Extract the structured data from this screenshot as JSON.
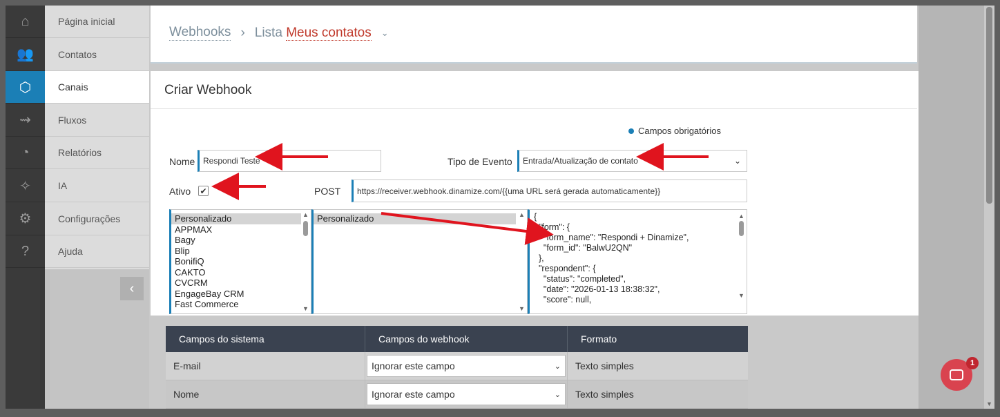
{
  "sidebar": {
    "items": [
      {
        "label": "Página inicial",
        "icon": "home-icon",
        "glyph": "⌂"
      },
      {
        "label": "Contatos",
        "icon": "contacts-icon",
        "glyph": "👥"
      },
      {
        "label": "Canais",
        "icon": "channels-icon",
        "glyph": "⬡"
      },
      {
        "label": "Fluxos",
        "icon": "flows-icon",
        "glyph": "⇝"
      },
      {
        "label": "Relatórios",
        "icon": "reports-icon",
        "glyph": "◔"
      },
      {
        "label": "IA",
        "icon": "ai-sparkle-icon",
        "glyph": "✧"
      },
      {
        "label": "Configurações",
        "icon": "settings-icon",
        "glyph": "⚙"
      },
      {
        "label": "Ajuda",
        "icon": "help-icon",
        "glyph": "?"
      }
    ],
    "active_index": 2,
    "collapse_glyph": "‹"
  },
  "breadcrumb": {
    "root": "Webhooks",
    "separator": "›",
    "list_prefix": "Lista",
    "list_name": "Meus contatos",
    "chevron": "⌄"
  },
  "form": {
    "title": "Criar Webhook",
    "required_note": "Campos obrigatórios",
    "name_label": "Nome",
    "name_value": "Respondi Teste",
    "event_label": "Tipo de Evento",
    "event_value": "Entrada/Atualização de contato",
    "active_label": "Ativo",
    "active_checked": "✔",
    "post_label": "POST",
    "post_url": "https://receiver.webhook.dinamize.com/{{uma URL será gerada automaticamente}}"
  },
  "integrations_list": [
    "Personalizado",
    "APPMAX",
    "Bagy",
    "Blip",
    "BonifiQ",
    "CAKTO",
    "CVCRM",
    "EngageBay CRM",
    "Fast Commerce"
  ],
  "templates_list": [
    "Personalizado"
  ],
  "json_lines": [
    "{",
    "  \"form\": {",
    "    \"form_name\": \"Respondi + Dinamize\",",
    "    \"form_id\": \"BalwU2QN\"",
    "  },",
    "  \"respondent\": {",
    "    \"status\": \"completed\",",
    "    \"date\": \"2026-01-13 18:38:32\",",
    "    \"score\": null,"
  ],
  "table": {
    "headers": [
      "Campos do sistema",
      "Campos do webhook",
      "Formato"
    ],
    "rows": [
      {
        "system": "E-mail",
        "webhook": "Ignorar este campo",
        "format": "Texto simples"
      },
      {
        "system": "Nome",
        "webhook": "Ignorar este campo",
        "format": "Texto simples"
      }
    ]
  },
  "chat": {
    "badge": "1"
  },
  "colors": {
    "accent": "#1b7fb6",
    "arrow": "#e0141e",
    "table_header": "#3a4250"
  }
}
